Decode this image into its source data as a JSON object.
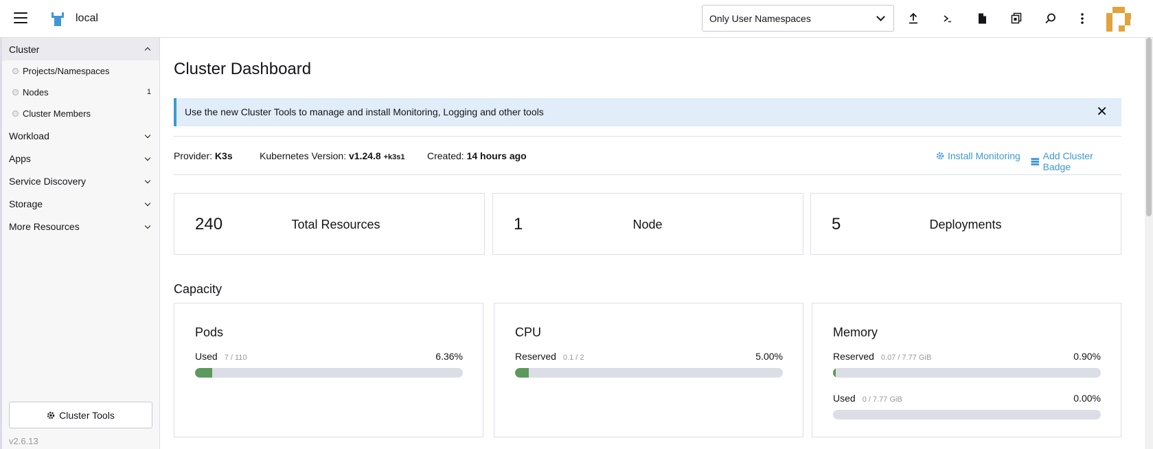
{
  "header": {
    "cluster_name": "local",
    "namespace_filter": "Only User Namespaces",
    "icons": [
      "upload-icon",
      "shell-icon",
      "file-icon",
      "copy-config-icon",
      "search-icon",
      "more-vertical-icon"
    ]
  },
  "sidebar": {
    "groups": [
      {
        "label": "Cluster",
        "expanded": true,
        "items": [
          {
            "label": "Projects/Namespaces",
            "count": ""
          },
          {
            "label": "Nodes",
            "count": "1"
          },
          {
            "label": "Cluster Members",
            "count": ""
          }
        ]
      },
      {
        "label": "Workload"
      },
      {
        "label": "Apps"
      },
      {
        "label": "Service Discovery"
      },
      {
        "label": "Storage"
      },
      {
        "label": "More Resources"
      }
    ],
    "cluster_tools_label": "Cluster Tools",
    "version": "v2.6.13"
  },
  "main": {
    "title": "Cluster Dashboard",
    "banner": "Use the new Cluster Tools to manage and install Monitoring, Logging and other tools",
    "meta": {
      "provider_label": "Provider:",
      "provider_value": "K3s",
      "k8s_label": "Kubernetes Version:",
      "k8s_value": "v1.24.8",
      "k8s_suffix": "+k3s1",
      "created_label": "Created:",
      "created_value": "14 hours ago",
      "install_monitoring": "Install Monitoring",
      "add_badge": "Add Cluster Badge"
    },
    "stats": [
      {
        "value": "240",
        "label": "Total Resources"
      },
      {
        "value": "1",
        "label": "Node"
      },
      {
        "value": "5",
        "label": "Deployments"
      }
    ],
    "capacity_title": "Capacity",
    "gauges": [
      {
        "title": "Pods",
        "rows": [
          {
            "label": "Used",
            "detail": "7 / 110",
            "percent_text": "6.36%",
            "fraction": 0.0636
          }
        ]
      },
      {
        "title": "CPU",
        "rows": [
          {
            "label": "Reserved",
            "detail": "0.1 / 2",
            "percent_text": "5.00%",
            "fraction": 0.05
          }
        ]
      },
      {
        "title": "Memory",
        "rows": [
          {
            "label": "Reserved",
            "detail": "0.07 / 7.77 GiB",
            "percent_text": "0.90%",
            "fraction": 0.009
          },
          {
            "label": "Used",
            "detail": "0 / 7.77 GiB",
            "percent_text": "0.00%",
            "fraction": 0.0
          }
        ]
      }
    ]
  },
  "colors": {
    "accent": "#3d98d3",
    "gauge_fill": "#5d995d",
    "banner_bg": "#e1edf8"
  }
}
